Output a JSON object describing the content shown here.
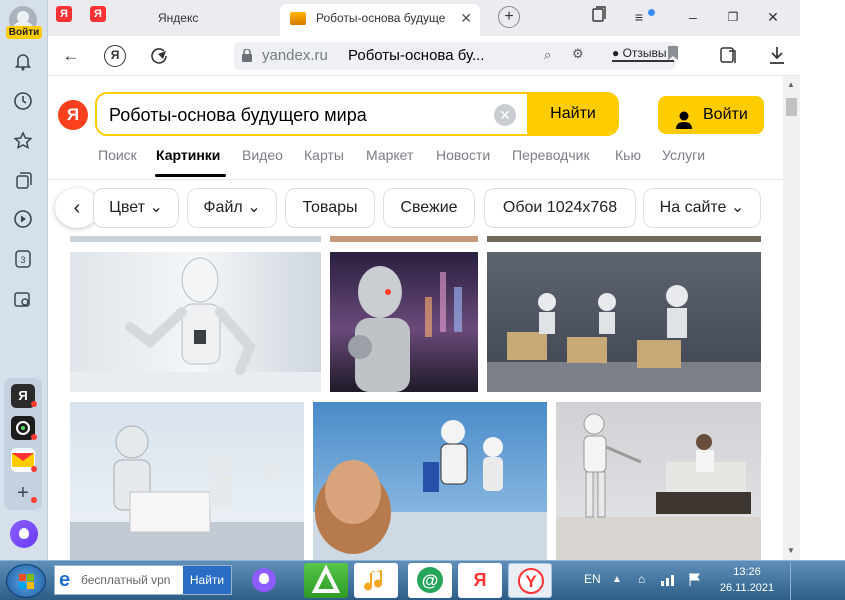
{
  "sidebar": {
    "login_badge": "Войти",
    "apps": [
      "Я",
      "3"
    ]
  },
  "tabs": [
    {
      "title": "Яндекс"
    },
    {
      "title": "Роботы-основа будуще"
    }
  ],
  "toolbar": {
    "domain": "yandex.ru",
    "page_title": "Роботы-основа бу...",
    "feedback": "Отзывы"
  },
  "search": {
    "logo": "Я",
    "query": "Роботы-основа будущего мира",
    "button": "Найти",
    "login": "Войти"
  },
  "services": [
    "Поиск",
    "Картинки",
    "Видео",
    "Карты",
    "Маркет",
    "Новости",
    "Переводчик",
    "Кью",
    "Услуги"
  ],
  "filters": [
    "Цвет",
    "Файл",
    "Товары",
    "Свежие",
    "Обои 1024x768",
    "На сайте"
  ],
  "taskbar": {
    "search_text": "бесплатный vpn",
    "search_button": "Найти",
    "lang": "EN",
    "time": "13:26",
    "date": "26.11.2021"
  },
  "colors": {
    "accent": "#ffcc00",
    "brand": "#fc3f1d"
  }
}
